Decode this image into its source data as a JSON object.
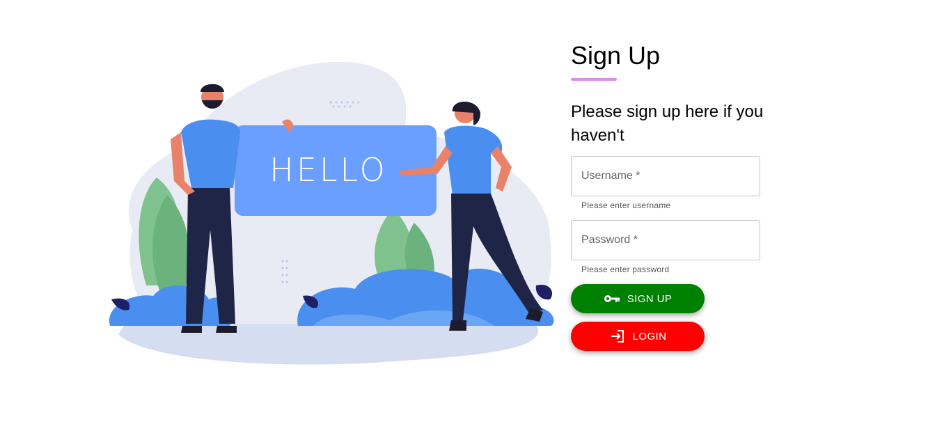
{
  "form": {
    "title": "Sign Up",
    "subtitle": "Please sign up here if you haven't",
    "username": {
      "placeholder": "Username *",
      "value": "",
      "helper": "Please enter username"
    },
    "password": {
      "placeholder": "Password *",
      "value": "",
      "helper": "Please enter password"
    },
    "signup_button": {
      "label": "SIGN UP",
      "icon": "key-icon",
      "color": "#008000"
    },
    "login_button": {
      "label": "LOGIN",
      "icon": "login-icon",
      "color": "#ff0000"
    },
    "accent_color": "#d98fe6"
  },
  "illustration": {
    "sign_text": "HELLO"
  }
}
